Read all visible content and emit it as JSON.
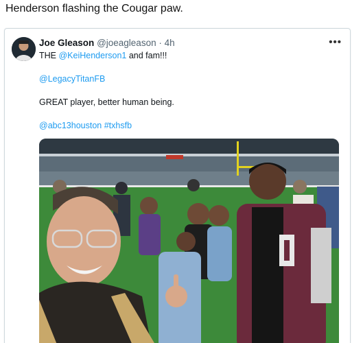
{
  "caption": "Henderson flashing the Cougar paw.",
  "tweet": {
    "display_name": "Joe Gleason",
    "handle": "@joeagleason",
    "separator": "·",
    "time": "4h",
    "more_icon": "more-horizontal-icon",
    "line1": {
      "prefix": "THE ",
      "mention": "@KeiHenderson1",
      "suffix": " and fam!!!"
    },
    "line2_mention": "@LegacyTitanFB",
    "line3": "GREAT player, better human being.",
    "line4": {
      "tag1": "@abc13houston",
      "space": " ",
      "tag2": "#txhsfb"
    },
    "link_color": "#1d9bf0"
  }
}
